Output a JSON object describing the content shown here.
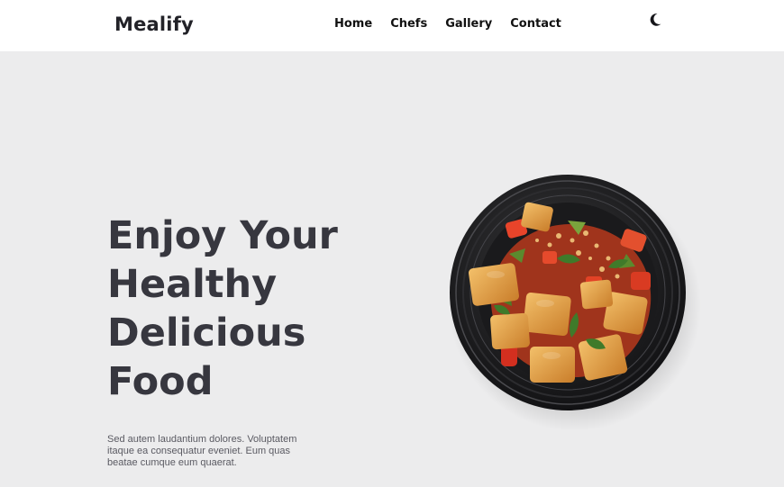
{
  "brand": {
    "name": "Mealify"
  },
  "nav": {
    "links": [
      {
        "label": "Home"
      },
      {
        "label": "Chefs"
      },
      {
        "label": "Gallery"
      },
      {
        "label": "Contact"
      }
    ],
    "theme_toggle_icon": "moon-icon"
  },
  "hero": {
    "title_lines": [
      "Enjoy Your",
      "Healthy",
      "Delicious",
      "Food"
    ],
    "description": "Sed autem laudantium dolores. Voluptatem itaque ea consequatur eveniet. Eum quas beatae cumque eum quaerat.",
    "image_icon": "food-bowl-image"
  },
  "colors": {
    "hero_background": "#ececed",
    "title_color": "#37373f",
    "nav_background": "#ffffff"
  }
}
